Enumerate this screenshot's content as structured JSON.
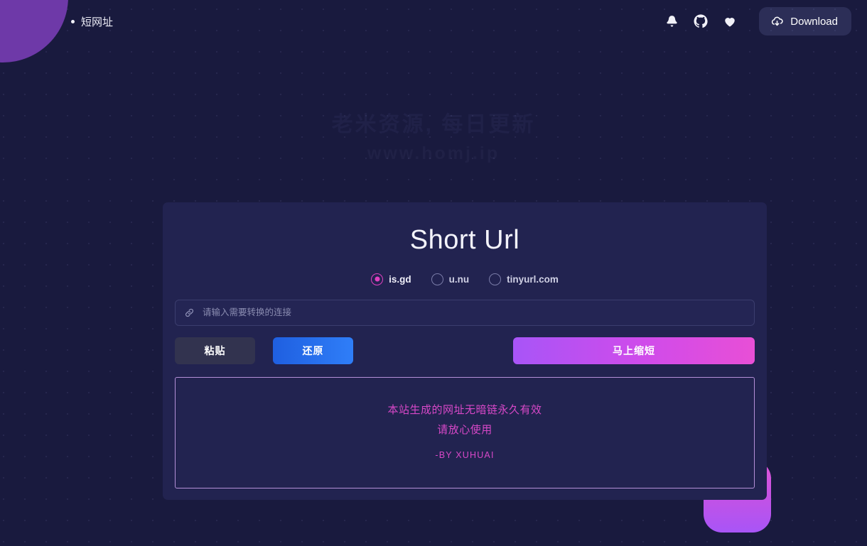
{
  "header": {
    "brand": "短网址",
    "icons": [
      {
        "name": "bell-icon",
        "label": "通知"
      },
      {
        "name": "github-icon",
        "label": "GitHub"
      },
      {
        "name": "heart-icon",
        "label": "喜欢"
      }
    ],
    "download_label": "Download",
    "download_icon": "cloud-download-icon"
  },
  "background": {
    "watermark_line1": "老米资源, 每日更新",
    "watermark_line2": "www.homj.ip",
    "page_bg": "#191a3e",
    "blob_purple": "#6e39a8",
    "square_gradient_from": "#e155d8",
    "square_gradient_to": "#a855f7"
  },
  "card": {
    "title": "Short Url",
    "services": [
      {
        "label": "is.gd",
        "selected": true
      },
      {
        "label": "u.nu",
        "selected": false
      },
      {
        "label": "tinyurl.com",
        "selected": false
      }
    ],
    "input": {
      "icon": "link-icon",
      "placeholder": "请输入需要转换的连接",
      "value": ""
    },
    "buttons": {
      "paste": "粘贴",
      "restore": "还原",
      "shorten": "马上缩短"
    },
    "result": {
      "line1": "本站生成的网址无暗链永久有效",
      "line2": "请放心使用",
      "signature": "-BY XUHUAI",
      "text_color": "#d848c8",
      "border_color": "#b48fd8"
    },
    "accent_colors": {
      "selected_radio": "#e040c0",
      "restore_button": "#2f7ef8",
      "shorten_button": "#d04bea",
      "card_bg": "#222350"
    }
  }
}
